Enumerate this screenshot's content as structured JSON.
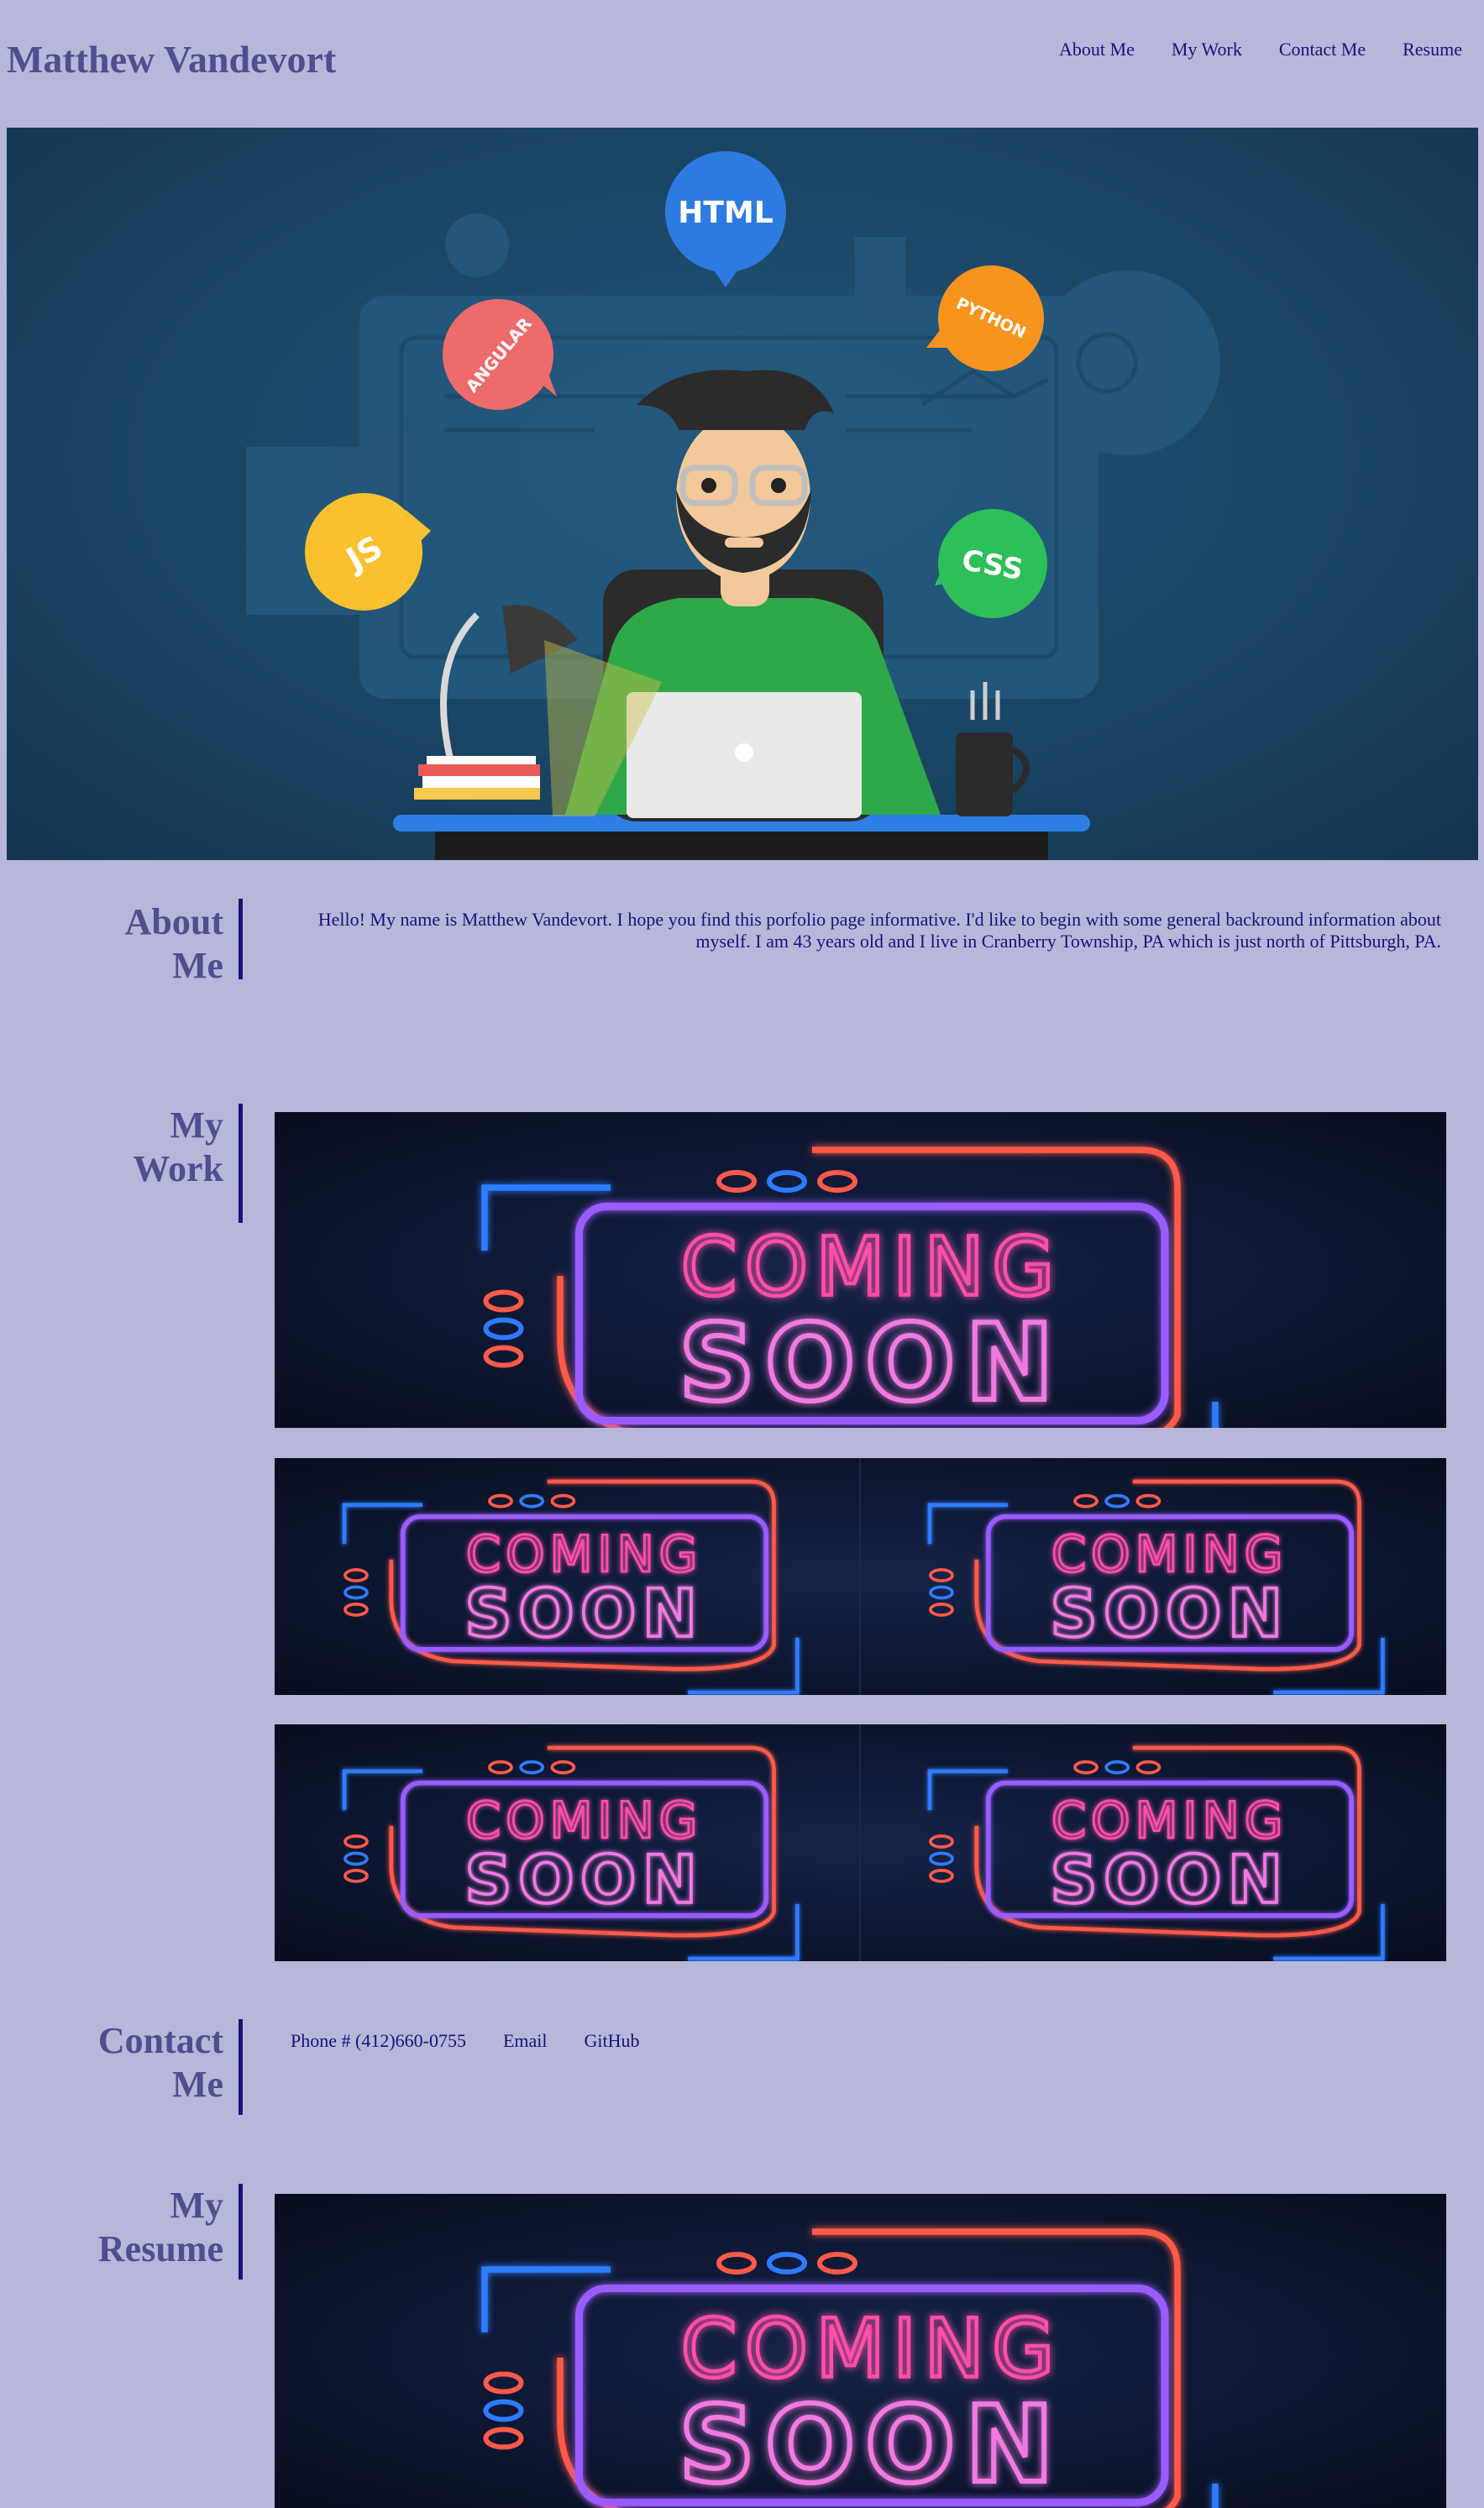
{
  "header": {
    "title": "Matthew Vandevort",
    "nav": [
      "About Me",
      "My Work",
      "Contact Me",
      "Resume"
    ]
  },
  "hero": {
    "bubbles": [
      "HTML",
      "ANGULAR",
      "PYTHON",
      "JS",
      "CSS"
    ]
  },
  "about": {
    "heading_line1": "About",
    "heading_line2": "Me",
    "text": "Hello! My name is Matthew Vandevort. I hope you find this porfolio page informative. I'd like to begin with some general backround information about myself. I am 43 years old and I live in Cranberry Township, PA which is just north of Pittsburgh, PA."
  },
  "work": {
    "heading_line1": "My",
    "heading_line2": "Work",
    "tile_line1": "COMING",
    "tile_line2": "SOON"
  },
  "contact": {
    "heading_line1": "Contact",
    "heading_line2": "Me",
    "phone": "Phone # (412)660-0755",
    "email": "Email",
    "github": "GitHub"
  },
  "resume": {
    "heading_line1": "My",
    "heading_line2": "Resume"
  },
  "colors": {
    "background": "#b7b7da",
    "heading": "#4d4f8f",
    "text": "#15157a",
    "hero_bg": "#1a4564",
    "neon_pink": "#ff4fa8",
    "neon_red": "#ff5a4a",
    "neon_purple": "#9b5cff",
    "neon_blue": "#2f7bff"
  }
}
